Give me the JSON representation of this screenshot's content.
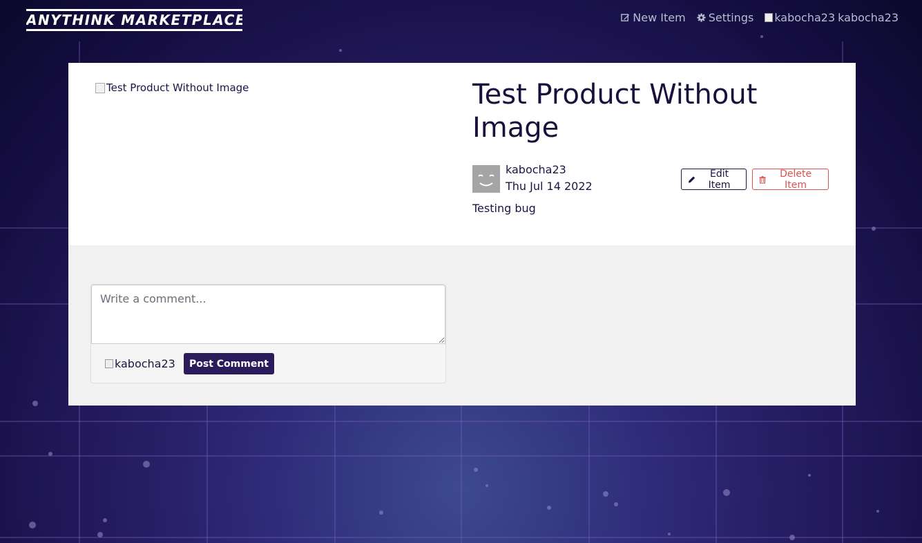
{
  "navbar": {
    "logo": "ANYTHINK MARKETPLACE",
    "new_item": "New Item",
    "settings": "Settings",
    "user_image_alt": "kabocha23",
    "username": "kabocha23"
  },
  "item": {
    "image_alt": "Test Product Without Image",
    "title": "Test Product Without Image",
    "seller": "kabocha23",
    "date": "Thu Jul 14 2022",
    "description": "Testing bug",
    "edit_label": "Edit Item",
    "delete_label": "Delete Item"
  },
  "comments": {
    "placeholder": "Write a comment...",
    "commenter_image_alt": "kabocha23",
    "post_label": "Post Comment"
  },
  "colors": {
    "primary": "#1e1344",
    "danger": "#d9534f",
    "button_dark": "#2b1a5c"
  },
  "icons": {
    "new_item": "edit-square-icon",
    "settings": "gear-icon",
    "edit": "pencil-icon",
    "delete": "trash-icon",
    "avatar": "smiley-avatar-icon",
    "broken_image": "broken-image-icon"
  }
}
